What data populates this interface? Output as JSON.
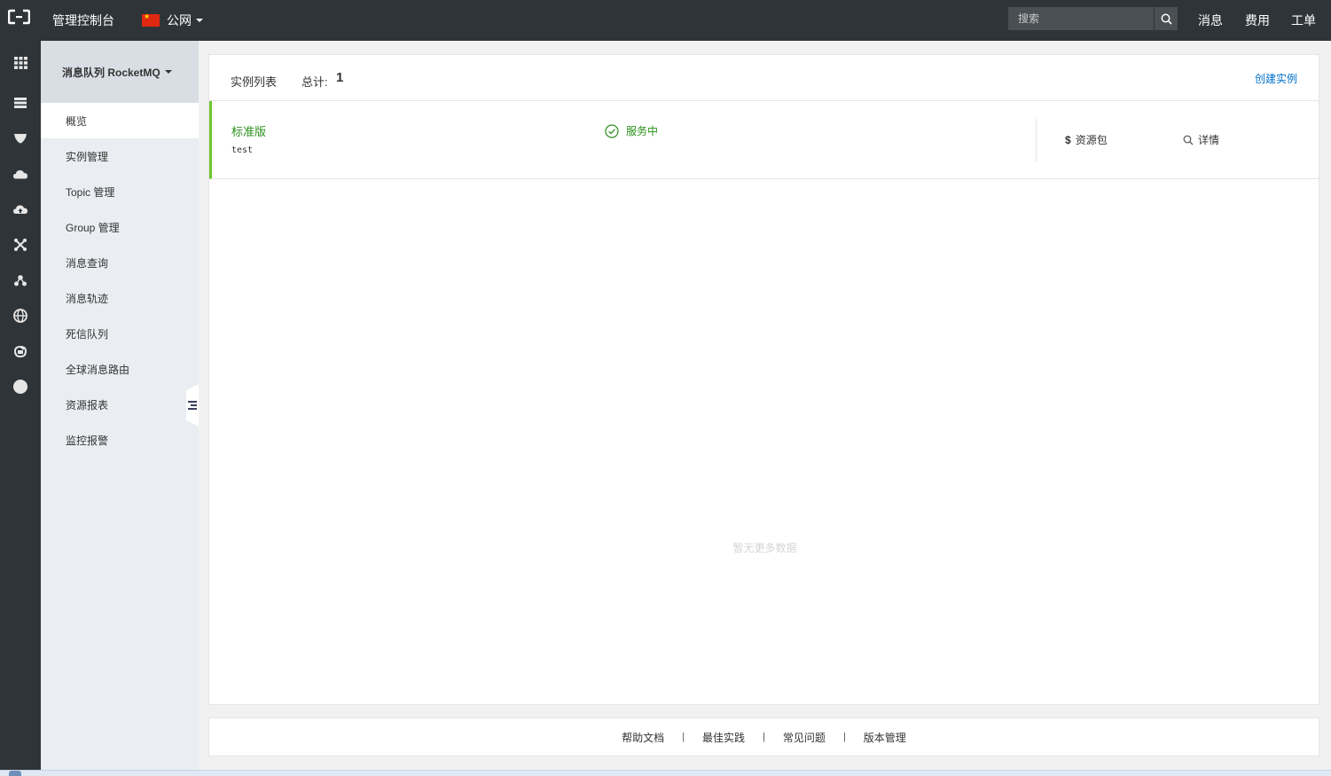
{
  "topbar": {
    "console_title": "管理控制台",
    "region": "公网",
    "search_placeholder": "搜索",
    "links": {
      "messages": "消息",
      "billing": "费用",
      "tickets": "工单"
    }
  },
  "rail": {
    "icons": [
      "grid-icon",
      "list-icon",
      "shield-icon",
      "cloud-icon",
      "cloud-upload-icon",
      "network-icon",
      "cluster-icon",
      "globe-icon",
      "mq-icon",
      "circle-icon"
    ]
  },
  "sidebar": {
    "product": "消息队列 RocketMQ",
    "items": [
      {
        "label": "概览",
        "active": true
      },
      {
        "label": "实例管理"
      },
      {
        "label": "Topic 管理"
      },
      {
        "label": "Group 管理"
      },
      {
        "label": "消息查询"
      },
      {
        "label": "消息轨迹"
      },
      {
        "label": "死信队列"
      },
      {
        "label": "全球消息路由"
      },
      {
        "label": "资源报表"
      },
      {
        "label": "监控报警"
      }
    ]
  },
  "main": {
    "list_title": "实例列表",
    "total_label": "总计:",
    "total_count": "1",
    "create_label": "创建实例",
    "instance": {
      "edition": "标准版",
      "name": "test",
      "status": "服务中",
      "resource_pack": "资源包",
      "details": "详情"
    },
    "empty_text": "暂无更多数据"
  },
  "footer": {
    "links": [
      "帮助文档",
      "最佳实践",
      "常见问题",
      "版本管理"
    ]
  },
  "colors": {
    "topbar": "#2f3438",
    "accent_green": "#2a8f1a",
    "row_marker": "#6fc82a",
    "link_blue": "#0070cc"
  }
}
